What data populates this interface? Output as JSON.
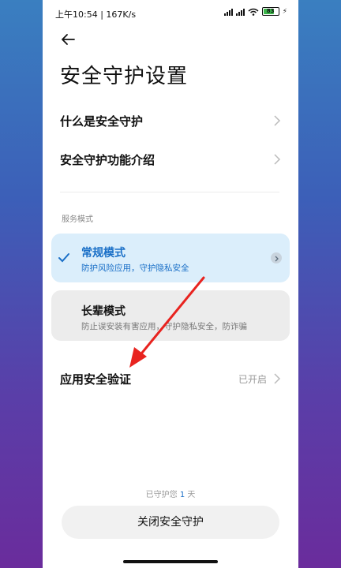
{
  "status_bar": {
    "time": "上午10:54 | 167K/s",
    "battery": "83"
  },
  "page": {
    "title": "安全守护设置"
  },
  "menu": [
    {
      "label": "什么是安全守护"
    },
    {
      "label": "安全守护功能介绍"
    }
  ],
  "service_mode": {
    "section_label": "服务模式",
    "modes": [
      {
        "title": "常规模式",
        "desc": "防护风险应用，守护隐私安全",
        "selected": true
      },
      {
        "title": "长辈模式",
        "desc": "防止误安装有害应用，守护隐私安全，防诈骗",
        "selected": false
      }
    ]
  },
  "app_verify": {
    "label": "应用安全验证",
    "status": "已开启"
  },
  "footer": {
    "protected_prefix": "已守护您",
    "protected_days": "1",
    "protected_suffix": "天",
    "close_button": "关闭安全守护"
  },
  "colors": {
    "accent": "#1a6fc7",
    "selected_card_bg": "#dbeefb",
    "annotation_arrow": "#e8231f"
  },
  "icons": [
    "back-arrow-icon",
    "chevron-right-icon",
    "check-icon",
    "signal-icon",
    "wifi-icon",
    "battery-icon"
  ]
}
